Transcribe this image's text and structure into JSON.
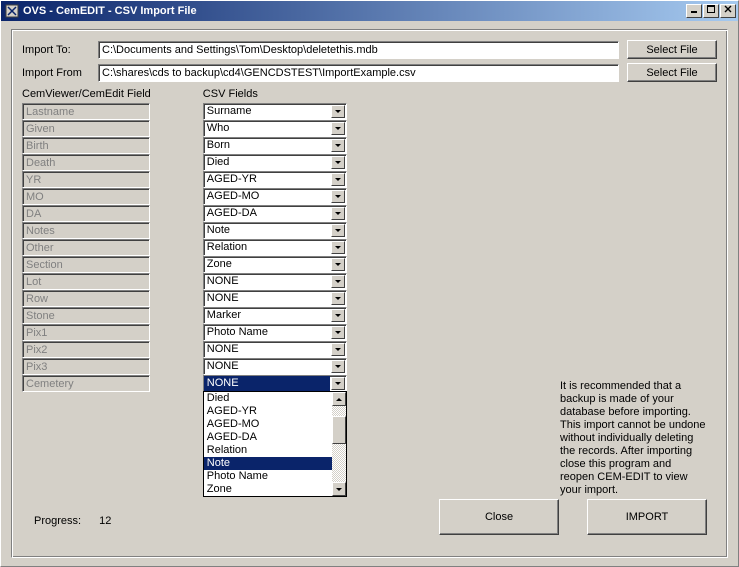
{
  "window": {
    "title": "OVS - CemEDIT - CSV Import File"
  },
  "labels": {
    "import_to": "Import To:",
    "import_from": "Import From",
    "cem_header": "CemViewer/CemEdit  Field",
    "csv_header": "CSV Fields",
    "progress": "Progress:",
    "select_file": "Select File",
    "close": "Close",
    "import": "IMPORT"
  },
  "paths": {
    "import_to": "C:\\Documents and Settings\\Tom\\Desktop\\deletethis.mdb",
    "import_from": "C:\\shares\\cds to backup\\cd4\\GENCDSTEST\\ImportExample.csv"
  },
  "cem_fields": [
    "Lastname",
    "Given",
    "Birth",
    "Death",
    "YR",
    "MO",
    "DA",
    "Notes",
    "Other",
    "Section",
    "Lot",
    "Row",
    "Stone",
    "Pix1",
    "Pix2",
    "Pix3",
    "Cemetery"
  ],
  "csv_fields": [
    "Surname",
    "Who",
    "Born",
    "Died",
    "AGED-YR",
    "AGED-MO",
    "AGED-DA",
    "Note",
    "Relation",
    "Zone",
    "NONE",
    "NONE",
    "Marker",
    "Photo Name",
    "NONE",
    "NONE",
    "NONE"
  ],
  "dropdown_options": [
    "Died",
    "AGED-YR",
    "AGED-MO",
    "AGED-DA",
    "Relation",
    "Note",
    "Photo Name",
    "Zone"
  ],
  "dropdown_highlight_index": 5,
  "csv_selected_index": 16,
  "recommend_text": "It is recommended that a backup is made of your database before importing. This import cannot be undone without individually deleting the records. After importing  close this program and reopen CEM-EDIT to view your import.",
  "progress_value": "12"
}
